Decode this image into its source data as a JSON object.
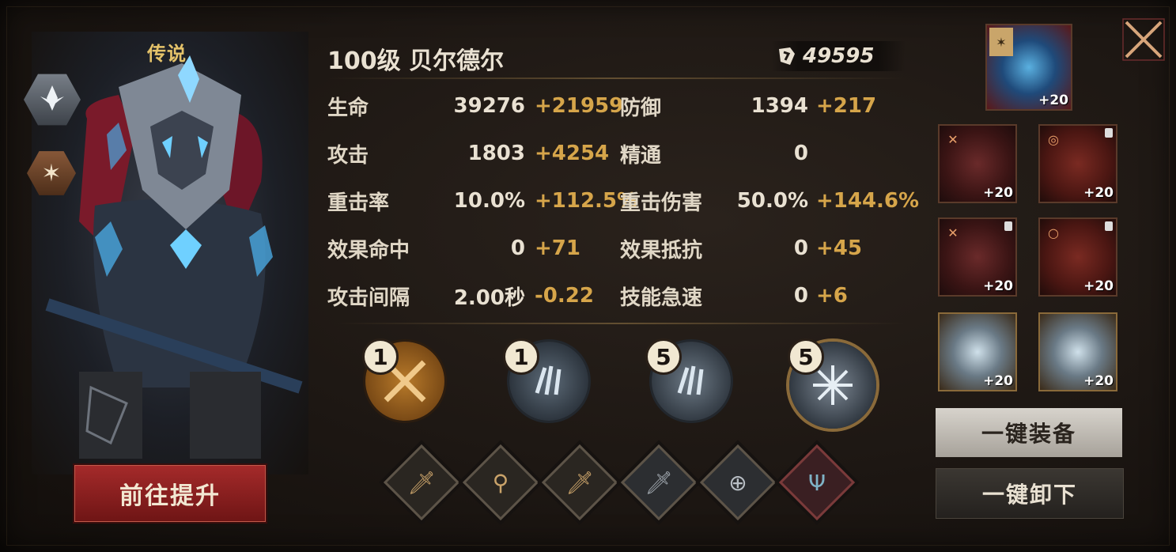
{
  "hero": {
    "rarity": "传说",
    "title": "100级  贝尔德尔",
    "power": "49595",
    "upgrade_button": "前往提升"
  },
  "stats": [
    {
      "label": "生命",
      "base": "39276",
      "bonus": "+21959"
    },
    {
      "label": "防御",
      "base": "1394",
      "bonus": "+217"
    },
    {
      "label": "攻击",
      "base": "1803",
      "bonus": "+4254"
    },
    {
      "label": "精通",
      "base": "0",
      "bonus": ""
    },
    {
      "label": "重击率",
      "base": "10.0%",
      "bonus": "+112.5%"
    },
    {
      "label": "重击伤害",
      "base": "50.0%",
      "bonus": "+144.6%"
    },
    {
      "label": "效果命中",
      "base": "0",
      "bonus": "+71"
    },
    {
      "label": "效果抵抗",
      "base": "0",
      "bonus": "+45"
    },
    {
      "label": "攻击间隔",
      "base": "2.00秒",
      "bonus": "-0.22"
    },
    {
      "label": "技能急速",
      "base": "0",
      "bonus": "+6"
    }
  ],
  "skills": [
    {
      "level": "1",
      "icon": "crossed-swords-icon"
    },
    {
      "level": "1",
      "icon": "ice-claw-icon"
    },
    {
      "level": "5",
      "icon": "ice-claw-icon"
    },
    {
      "level": "5",
      "icon": "ice-burst-icon"
    }
  ],
  "runes": [
    {
      "icon": "sword-icon",
      "color": "#caa36a"
    },
    {
      "icon": "sword-in-stone-icon",
      "color": "#caa36a"
    },
    {
      "icon": "sword-icon",
      "color": "#caa36a"
    },
    {
      "icon": "sword-icon",
      "color": "#9fa6ad"
    },
    {
      "icon": "plus-minus-icon",
      "color": "#b8bec4"
    },
    {
      "icon": "trident-icon",
      "color": "#7fb3c6"
    }
  ],
  "equipment": [
    {
      "name": "ice-crystal-artifact",
      "level": "+20",
      "locked": false
    },
    {
      "name": "helmet",
      "level": "+20",
      "locked": false
    },
    {
      "name": "gun",
      "level": "+20",
      "locked": true
    },
    {
      "name": "chest-armor",
      "level": "+20",
      "locked": true
    },
    {
      "name": "gauntlet",
      "level": "+20",
      "locked": true
    },
    {
      "name": "ice-gem-left",
      "level": "+20",
      "locked": false
    },
    {
      "name": "ice-gem-right",
      "level": "+20",
      "locked": false
    }
  ],
  "buttons": {
    "equip_all": "一键装备",
    "unequip_all": "一键卸下"
  },
  "colors": {
    "gold": "#d6a54a",
    "red_button": "#a42a2a",
    "text": "#e9e1d2"
  }
}
